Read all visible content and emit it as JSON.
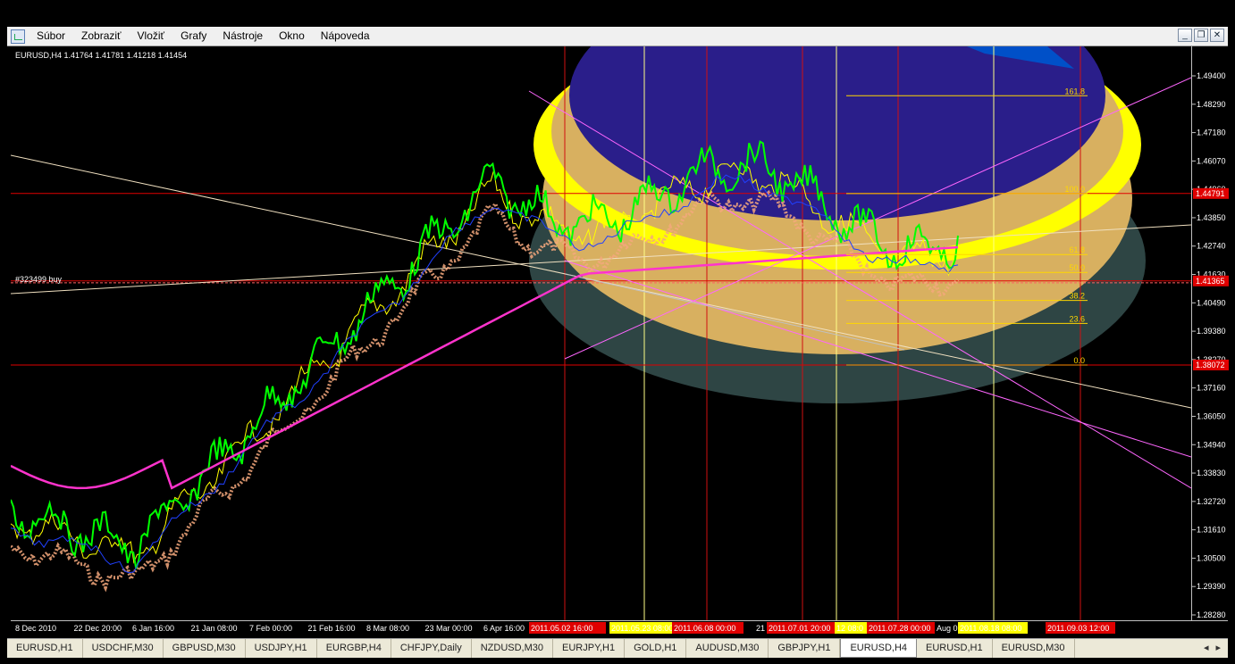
{
  "menu": [
    "Súbor",
    "Zobraziť",
    "Vložiť",
    "Grafy",
    "Nástroje",
    "Okno",
    "Nápoveda"
  ],
  "window_buttons": [
    "_",
    "❐",
    "✕"
  ],
  "chart_header": "EURUSD,H4  1.41764 1.41781 1.41218 1.41454",
  "order_label": "#323499 buy",
  "price_axis": [
    "1.49400",
    "1.48290",
    "1.47180",
    "1.46070",
    "1.44960",
    "1.43850",
    "1.42740",
    "1.41630",
    "1.40490",
    "1.39380",
    "1.38270",
    "1.37160",
    "1.36050",
    "1.34940",
    "1.33830",
    "1.32720",
    "1.31610",
    "1.30500",
    "1.29390",
    "1.28280"
  ],
  "price_tags": [
    {
      "text": "1.44791",
      "price": 1.44791,
      "color": "#e00000"
    },
    {
      "text": "1.41365",
      "price": 1.41365,
      "color": "#e00000"
    },
    {
      "text": "1.38072",
      "price": 1.38072,
      "color": "#e00000"
    }
  ],
  "date_axis": [
    "8 Dec 2010",
    "22 Dec 20:00",
    "6 Jan 16:00",
    "21 Jan 08:00",
    "7 Feb 00:00",
    "21 Feb 16:00",
    "8 Mar 08:00",
    "23 Mar 00:00",
    "6 Apr 16:00"
  ],
  "date_tags": [
    {
      "text": "2011.05.02 16:00",
      "color": "#e00000"
    },
    {
      "text": "2011.05.23 08:00",
      "color": "#ffff00"
    },
    {
      "text": "2011.06.08 00:00",
      "color": "#e00000"
    },
    {
      "text": "21",
      "color": ""
    },
    {
      "text": "2011.07.01 20:00",
      "color": "#e00000"
    },
    {
      "text": "12 08:0",
      "color": "#ffff00"
    },
    {
      "text": "2011.07.28 00:00",
      "color": "#e00000"
    },
    {
      "text": "Aug 0",
      "color": ""
    },
    {
      "text": "2011.08.18 08:00",
      "color": "#ffff00"
    },
    {
      "text": "2011.09.03 12:00",
      "color": "#e00000"
    }
  ],
  "fibo_levels": [
    {
      "label": "161.8",
      "price": 1.4862
    },
    {
      "label": "100.0",
      "price": 1.4479
    },
    {
      "label": "61.8",
      "price": 1.424
    },
    {
      "label": "50.0",
      "price": 1.417
    },
    {
      "label": "38.2",
      "price": 1.406
    },
    {
      "label": "23.6",
      "price": 1.397
    },
    {
      "label": "0.0",
      "price": 1.3807
    }
  ],
  "tabs": [
    {
      "label": "EURUSD,H1",
      "active": false
    },
    {
      "label": "USDCHF,M30",
      "active": false
    },
    {
      "label": "GBPUSD,M30",
      "active": false
    },
    {
      "label": "USDJPY,H1",
      "active": false
    },
    {
      "label": "EURGBP,H4",
      "active": false
    },
    {
      "label": "CHFJPY,Daily",
      "active": false
    },
    {
      "label": "NZDUSD,M30",
      "active": false
    },
    {
      "label": "EURJPY,H1",
      "active": false
    },
    {
      "label": "GOLD,H1",
      "active": false
    },
    {
      "label": "AUDUSD,M30",
      "active": false
    },
    {
      "label": "GBPJPY,H1",
      "active": false
    },
    {
      "label": "EURUSD,H4",
      "active": true
    },
    {
      "label": "EURUSD,H1",
      "active": false
    },
    {
      "label": "EURUSD,M30",
      "active": false
    }
  ],
  "tab_arrows": [
    "◂",
    "▸"
  ],
  "colors": {
    "price_line": "#00ff00",
    "signal_line": "#ffff00",
    "ma_line": "#ff33cc",
    "trend": "#ff66ff",
    "grid_red": "#d01010",
    "cloud": "#f4a87c"
  },
  "chart_data": {
    "type": "line",
    "ylim": [
      1.2828,
      1.494
    ],
    "series": []
  }
}
